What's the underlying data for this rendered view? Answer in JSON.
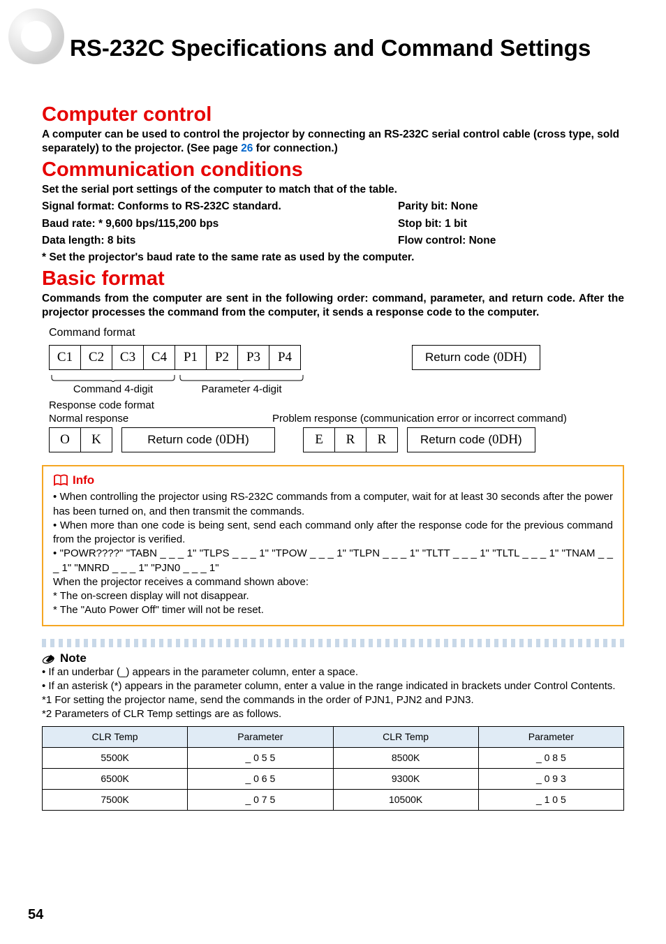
{
  "page": {
    "title": "RS-232C Specifications and Command Settings",
    "number": "54"
  },
  "sec_computer": {
    "heading": "Computer control",
    "body": "A computer can be used to control the projector by connecting an RS-232C serial control cable (cross type, sold separately) to the projector. (See page ",
    "link_page": "26",
    "body_after": " for connection.)"
  },
  "sec_comm": {
    "heading": "Communication conditions",
    "intro": "Set the serial port settings of the computer to match that of the table.",
    "l1": "Signal format: Conforms to RS-232C standard.",
    "r1": "Parity bit: None",
    "l2": "Baud rate: * 9,600 bps/115,200 bps",
    "r2": "Stop bit: 1 bit",
    "l3": "Data length: 8 bits",
    "r3": "Flow control: None",
    "foot": "* Set the projector's baud rate to the same rate as used by the computer."
  },
  "sec_basic": {
    "heading": "Basic format",
    "body": "Commands from the computer are sent in the following order: command, parameter, and return code. After the projector processes the command from the computer, it sends a response code to the computer.",
    "command_format_label": "Command format",
    "cells": {
      "c1": "C1",
      "c2": "C2",
      "c3": "C3",
      "c4": "C4",
      "p1": "P1",
      "p2": "P2",
      "p3": "P3",
      "p4": "P4"
    },
    "return_label": "Return code (",
    "return_code": "0DH",
    "return_close": ")",
    "cmd4": "Command 4-digit",
    "param4": "Parameter 4-digit",
    "response_format": "Response code format",
    "normal": "Normal response",
    "problem": "Problem response (communication error or incorrect command)",
    "ok": {
      "o": "O",
      "k": "K"
    },
    "err": {
      "e": "E",
      "r1": "R",
      "r2": "R"
    }
  },
  "info": {
    "heading": "Info",
    "b1": "When controlling the projector using RS-232C commands from a computer, wait for at least 30 seconds after the power has been turned on, and then transmit the commands.",
    "b2": "When more than one code is being sent, send each command only after the response code for the previous command from the projector is verified.",
    "b3": "\"POWR????\" \"TABN _ _ _ 1\" \"TLPS _ _ _ 1\" \"TPOW _ _ _ 1\" \"TLPN _ _ _ 1\" \"TLTT _ _ _ 1\" \"TLTL _ _ _ 1\" \"TNAM _ _ _ 1\" \"MNRD _ _ _ 1\" \"PJN0 _ _ _ 1\"",
    "after": "When the projector receives a command shown above:",
    "after1": "* The on-screen display will not disappear.",
    "after2": "* The \"Auto Power Off\" timer will not be reset."
  },
  "note": {
    "heading": "Note",
    "b1": "If an underbar (_) appears in the parameter column, enter a space.",
    "b2": "If an asterisk (*) appears in the parameter column, enter a value in the range indicated in brackets under Control Contents.",
    "f1": "*1 For setting the projector name, send the commands in the order of PJN1, PJN2 and PJN3.",
    "f2": "*2 Parameters of CLR Temp settings are as follows."
  },
  "clr_table": {
    "h1": "CLR Temp",
    "h2": "Parameter",
    "h3": "CLR Temp",
    "h4": "Parameter",
    "rows": [
      {
        "c1": "5500K",
        "c2": "_ 0 5 5",
        "c3": "8500K",
        "c4": "_ 0 8 5"
      },
      {
        "c1": "6500K",
        "c2": "_ 0 6 5",
        "c3": "9300K",
        "c4": "_ 0 9 3"
      },
      {
        "c1": "7500K",
        "c2": "_ 0 7 5",
        "c3": "10500K",
        "c4": "_ 1 0 5"
      }
    ]
  }
}
